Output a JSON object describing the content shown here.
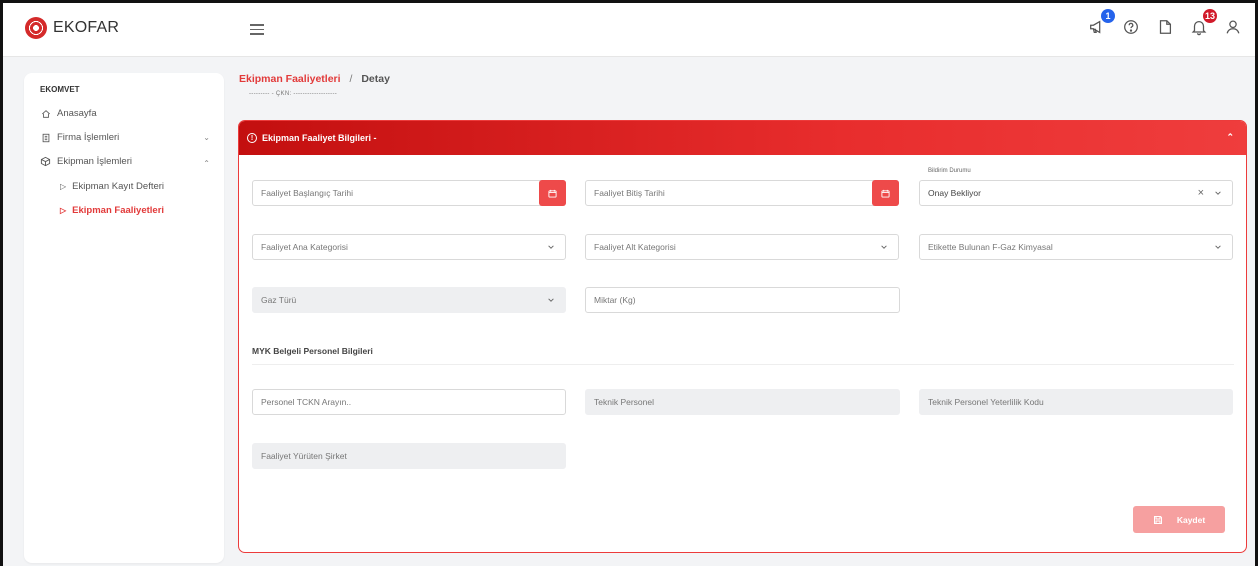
{
  "header": {
    "brand": "EKOFAR",
    "badges": {
      "announcements": "1",
      "notifications": "13"
    }
  },
  "colors": {
    "accent": "#e23a3a",
    "badge_blue": "#2563eb",
    "badge_red": "#d11a2a"
  },
  "sidebar": {
    "section": "EKOMVET",
    "items": [
      {
        "label": "Anasayfa",
        "icon": "home-icon"
      },
      {
        "label": "Firma İşlemleri",
        "icon": "building-icon"
      },
      {
        "label": "Ekipman İşlemleri",
        "icon": "box-icon"
      }
    ],
    "subitems": [
      {
        "label": "Ekipman Kayıt Defteri",
        "active": false
      },
      {
        "label": "Ekipman Faaliyetleri",
        "active": true
      }
    ]
  },
  "breadcrumb": {
    "parent": "Ekipman Faaliyetleri",
    "separator": "/",
    "current": "Detay",
    "sub": "---------  - ÇKN: -------------------"
  },
  "card": {
    "title": "Ekipman Faaliyet Bilgileri -",
    "fields": {
      "start_date": {
        "placeholder": "Faaliyet Başlangıç Tarihi"
      },
      "end_date": {
        "placeholder": "Faaliyet Bitiş Tarihi"
      },
      "status": {
        "label": "Bildirim Durumu",
        "value": "Onay Bekliyor"
      },
      "main_category": {
        "placeholder": "Faaliyet Ana Kategorisi"
      },
      "sub_category": {
        "placeholder": "Faaliyet Alt Kategorisi"
      },
      "label_gas": {
        "placeholder": "Etikette Bulunan F-Gaz Kimyasal"
      },
      "gas_type": {
        "placeholder": "Gaz Türü"
      },
      "amount": {
        "placeholder": "Miktar (Kg)"
      }
    },
    "section_title": "MYK Belgeli Personel Bilgileri",
    "personnel": {
      "tckn": {
        "placeholder": "Personel TCKN Arayın.."
      },
      "tech_staff": {
        "placeholder": "Teknik Personel"
      },
      "competence_code": {
        "placeholder": "Teknik Personel Yeterlilik Kodu"
      },
      "company": {
        "placeholder": "Faaliyet Yürüten Şirket"
      }
    },
    "save_label": "Kaydet"
  }
}
